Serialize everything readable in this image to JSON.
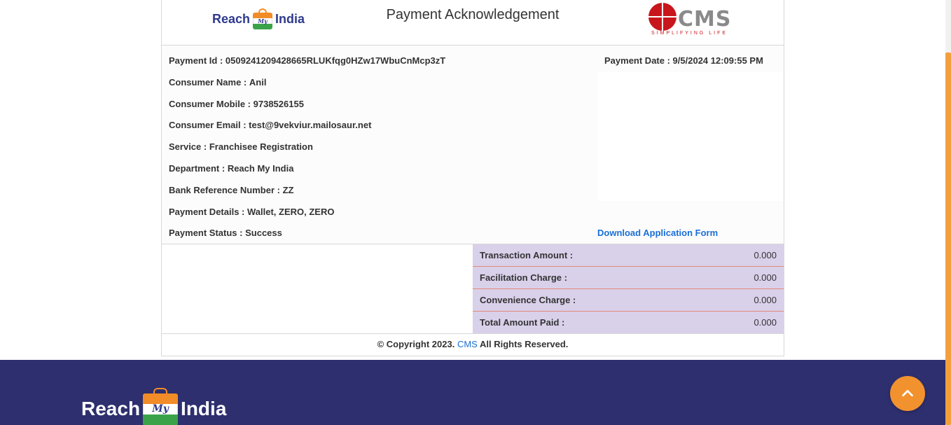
{
  "header": {
    "brand_left": {
      "word1": "Reach",
      "word_mid": "My",
      "word2": "India"
    },
    "title": "Payment Acknowledgement",
    "brand_right": {
      "word": "CMS",
      "tagline": "SIMPLIFYING LIFE"
    }
  },
  "details": {
    "payment_id": {
      "label": "Payment Id :",
      "value": "0509241209428665RLUKfqg0HZw17WbuCnMcp3zT"
    },
    "payment_date": {
      "label": "Payment Date :",
      "value": "9/5/2024 12:09:55 PM"
    },
    "consumer_name": {
      "label": "Consumer Name :",
      "value": "Anil"
    },
    "consumer_mobile": {
      "label": "Consumer Mobile :",
      "value": "9738526155"
    },
    "consumer_email": {
      "label": "Consumer Email :",
      "value": "test@9vekviur.mailosaur.net"
    },
    "service": {
      "label": "Service :",
      "value": "Franchisee Registration"
    },
    "department": {
      "label": "Department :",
      "value": "Reach My India"
    },
    "bank_ref": {
      "label": "Bank Reference Number :",
      "value": "ZZ"
    },
    "payment_details": {
      "label": "Payment Details :",
      "value": "Wallet, ZERO, ZERO"
    },
    "payment_status": {
      "label": "Payment Status :",
      "value": "Success"
    },
    "download_link": "Download Application Form"
  },
  "amounts": [
    {
      "label": "Transaction Amount :",
      "value": "0.000"
    },
    {
      "label": "Facilitation Charge :",
      "value": "0.000"
    },
    {
      "label": "Convenience Charge :",
      "value": "0.000"
    },
    {
      "label": "Total Amount Paid :",
      "value": "0.000"
    }
  ],
  "copyright": {
    "prefix": "© Copyright 2023.",
    "link": "CMS",
    "suffix": "All Rights Reserved."
  },
  "footer": {
    "word1": "Reach",
    "word_mid": "My",
    "word2": "India"
  },
  "icons": {
    "scroll_top": "chevron-up-icon"
  },
  "colors": {
    "brand_navy": "#2d2f6e",
    "accent_orange": "#f2922e",
    "amount_bg": "#d9d0ea",
    "link_blue": "#1a6fd6",
    "cms_red": "#c8161d"
  }
}
